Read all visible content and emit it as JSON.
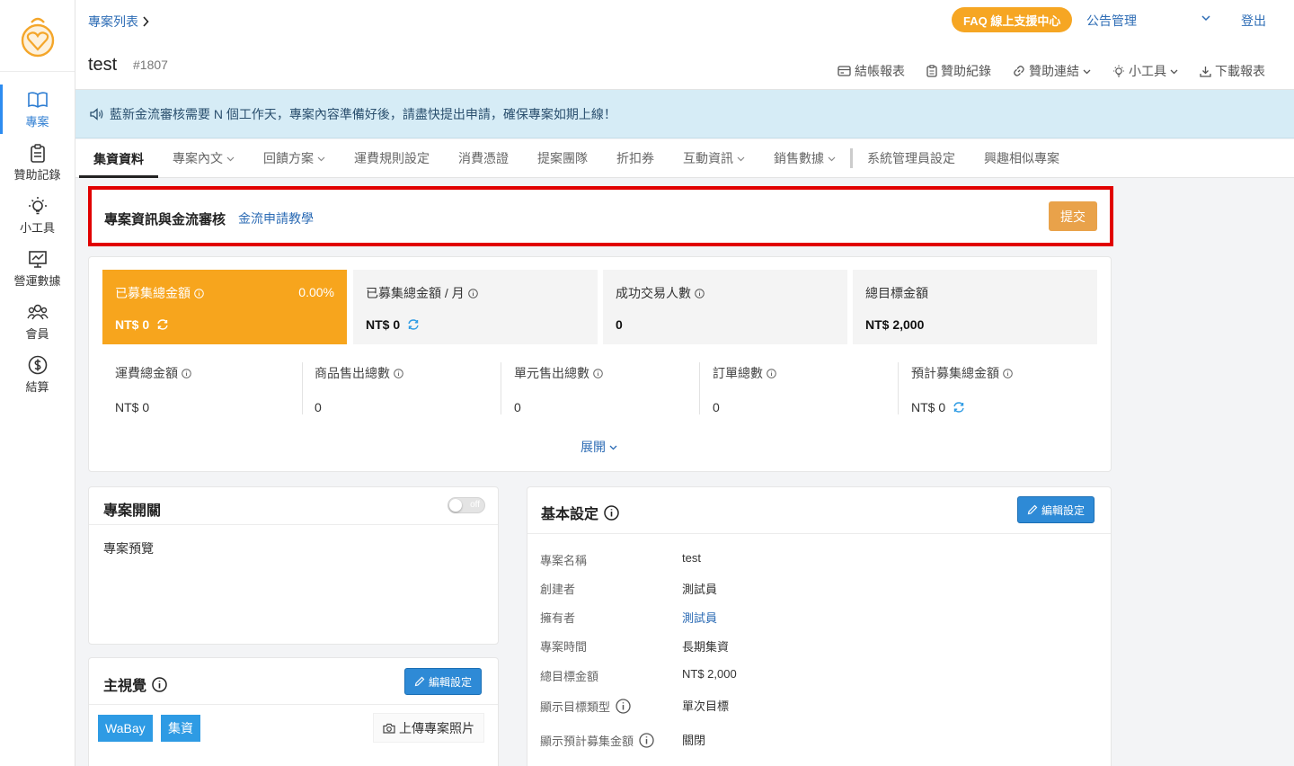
{
  "sidebar": {
    "items": [
      {
        "label": "專案",
        "icon": "book-icon",
        "active": true
      },
      {
        "label": "贊助記錄",
        "icon": "clipboard-icon",
        "active": false
      },
      {
        "label": "小工具",
        "icon": "lightbulb-icon",
        "active": false
      },
      {
        "label": "營運數據",
        "icon": "chart-icon",
        "active": false
      },
      {
        "label": "會員",
        "icon": "users-icon",
        "active": false
      },
      {
        "label": "結算",
        "icon": "dollar-icon",
        "active": false
      }
    ]
  },
  "header": {
    "breadcrumb": "專案列表",
    "faq": "FAQ 線上支援中心",
    "announcement": "公告管理",
    "logout": "登出",
    "title": "test",
    "id": "#1807",
    "tools": [
      {
        "label": "結帳報表",
        "icon": "card-icon",
        "dropdown": false
      },
      {
        "label": "贊助紀錄",
        "icon": "clipboard-icon",
        "dropdown": false
      },
      {
        "label": "贊助連結",
        "icon": "link-icon",
        "dropdown": true
      },
      {
        "label": "小工具",
        "icon": "lightbulb-icon",
        "dropdown": true
      },
      {
        "label": "下載報表",
        "icon": "download-icon",
        "dropdown": false
      }
    ]
  },
  "notice": "藍新金流審核需要 N 個工作天，專案內容準備好後，請盡快提出申請，確保專案如期上線！",
  "tabs": [
    {
      "label": "集資資料",
      "active": true,
      "dropdown": false
    },
    {
      "label": "專案內文",
      "active": false,
      "dropdown": true
    },
    {
      "label": "回饋方案",
      "active": false,
      "dropdown": true
    },
    {
      "label": "運費規則設定",
      "active": false,
      "dropdown": false
    },
    {
      "label": "消費憑證",
      "active": false,
      "dropdown": false
    },
    {
      "label": "提案團隊",
      "active": false,
      "dropdown": false
    },
    {
      "label": "折扣券",
      "active": false,
      "dropdown": false
    },
    {
      "label": "互動資訊",
      "active": false,
      "dropdown": true
    },
    {
      "label": "銷售數據",
      "active": false,
      "dropdown": true
    },
    {
      "label": "系統管理員設定",
      "active": false,
      "dropdown": false
    },
    {
      "label": "興趣相似專案",
      "active": false,
      "dropdown": false
    }
  ],
  "review": {
    "title": "專案資訊與金流審核",
    "link": "金流申請教學",
    "submit": "提交"
  },
  "stats": {
    "cards": [
      {
        "label": "已募集總金額",
        "value": "NT$ 0",
        "percent": "0.00%"
      },
      {
        "label": "已募集總金額 / 月",
        "value": "NT$ 0"
      },
      {
        "label": "成功交易人數",
        "value": "0"
      },
      {
        "label": "總目標金額",
        "value": "NT$ 2,000"
      }
    ],
    "sub": [
      {
        "label": "運費總金額",
        "value": "NT$ 0"
      },
      {
        "label": "商品售出總數",
        "value": "0"
      },
      {
        "label": "單元售出總數",
        "value": "0"
      },
      {
        "label": "訂單總數",
        "value": "0"
      },
      {
        "label": "預計募集總金額",
        "value": "NT$ 0"
      }
    ],
    "expand": "展開"
  },
  "switch_card": {
    "title": "專案開關",
    "toggle": "off",
    "preview": "專案預覽"
  },
  "visual_card": {
    "title": "主視覺",
    "edit": "編輯設定",
    "tags": [
      "WaBay",
      "集資"
    ],
    "upload": "上傳專案照片"
  },
  "basic": {
    "title": "基本設定",
    "edit": "編輯設定",
    "rows": [
      {
        "key": "專案名稱",
        "value": "test"
      },
      {
        "key": "創建者",
        "value": "測試員"
      },
      {
        "key": "擁有者",
        "value": "測試員"
      },
      {
        "key": "專案時間",
        "value": "長期集資"
      },
      {
        "key": "總目標金額",
        "value": "NT$ 2,000"
      },
      {
        "key": "顯示目標類型",
        "value": "單次目標"
      },
      {
        "key": "顯示預計募集金額",
        "value": "關閉"
      }
    ]
  },
  "colors": {
    "accent": "#f7a51d",
    "link": "#2d6cb5",
    "primary": "#2e8ad6",
    "highlight": "#e10000"
  }
}
